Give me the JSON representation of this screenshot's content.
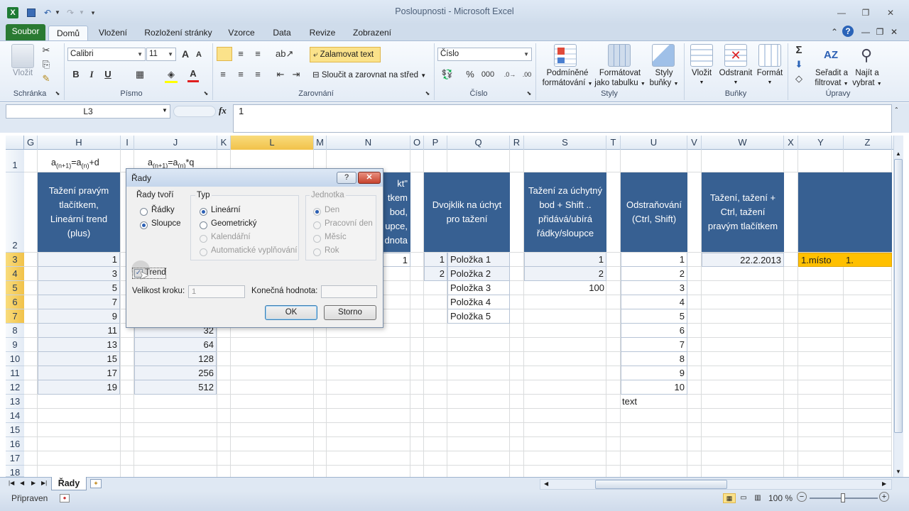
{
  "window": {
    "title": "Posloupnosti - Microsoft Excel"
  },
  "tabs": [
    "Soubor",
    "Domů",
    "Vložení",
    "Rozložení stránky",
    "Vzorce",
    "Data",
    "Revize",
    "Zobrazení"
  ],
  "ribbon": {
    "clipboard": {
      "paste": "Vložit",
      "label": "Schránka"
    },
    "font": {
      "name": "Calibri",
      "size": "11",
      "bold": "B",
      "italic": "I",
      "underline": "U",
      "label": "Písmo",
      "grow": "A",
      "shrink": "A"
    },
    "alignment": {
      "wrap": "Zalamovat text",
      "merge": "Sloučit a zarovnat na střed",
      "label": "Zarovnání"
    },
    "number": {
      "format": "Číslo",
      "percent": "%",
      "thousands": "000",
      "label": "Číslo"
    },
    "styles": {
      "conditional": [
        "Podmíněné",
        "formátování"
      ],
      "table": [
        "Formátovat",
        "jako tabulku"
      ],
      "cell": [
        "Styly",
        "buňky"
      ],
      "label": "Styly"
    },
    "cells": {
      "insert": "Vložit",
      "delete": "Odstranit",
      "format": "Formát",
      "label": "Buňky"
    },
    "editing": {
      "sigma": "Σ",
      "sort": [
        "Seřadit a",
        "filtrovat"
      ],
      "find": [
        "Najít a",
        "vybrat"
      ],
      "label": "Úpravy"
    }
  },
  "formula_bar": {
    "name_box": "L3",
    "fx": "fx",
    "value": "1"
  },
  "columns": [
    "G",
    "H",
    "I",
    "J",
    "K",
    "L",
    "M",
    "N",
    "O",
    "P",
    "Q",
    "R",
    "S",
    "T",
    "U",
    "V",
    "W",
    "X",
    "Y",
    "Z"
  ],
  "rows": [
    "1",
    "2",
    "3",
    "4",
    "5",
    "6",
    "7",
    "8",
    "9",
    "10",
    "11",
    "12",
    "13",
    "14",
    "15",
    "16",
    "17",
    "18"
  ],
  "sheet": {
    "formula_h": {
      "base": "a",
      "s1": "(n+1)",
      "mid": "=a",
      "s2": "(n)",
      "tail": "+d"
    },
    "formula_j": {
      "base": "a",
      "s1": "(n+1)",
      "mid": "=a",
      "s2": "(n)",
      "tail": "*q"
    },
    "header_h": "Tažení pravým tlačítkem, Lineární trend (plus)",
    "values_h": [
      "1",
      "3",
      "5",
      "7",
      "9",
      "11",
      "13",
      "15",
      "17",
      "19"
    ],
    "values_j": [
      "32",
      "64",
      "128",
      "256",
      "512"
    ],
    "header_n": [
      "kt\"",
      "tkem",
      "bod,",
      "upce,",
      "dnota"
    ],
    "value_n": "1",
    "header_q": "Dvojklik na úchyt pro tažení",
    "values_p": [
      "1",
      "2"
    ],
    "values_q": [
      "Položka 1",
      "Položka 2",
      "Položka 3",
      "Položka 4",
      "Položka 5"
    ],
    "header_s": "Tažení za úchytný bod + Shift .. přidává/ubírá řádky/sloupce",
    "values_s": [
      "1",
      "2",
      "100"
    ],
    "header_u": "Odstraňování (Ctrl, Shift)",
    "values_u": [
      "1",
      "2",
      "3",
      "4",
      "5",
      "6",
      "7",
      "8",
      "9",
      "10"
    ],
    "text_u": "text",
    "header_w": "Tažení, tažení + Ctrl, tažení pravým tlačítkem",
    "value_w": "22.2.2013",
    "value_y": "1.místo",
    "value_z": "1."
  },
  "dialog": {
    "title": "Řady",
    "help": "?",
    "close": "✕",
    "rady_tvori": {
      "legend": "Řady tvoří",
      "options": [
        "Řádky",
        "Sloupce"
      ],
      "selected": "Sloupce"
    },
    "typ": {
      "legend": "Typ",
      "options": [
        "Lineární",
        "Geometrický",
        "Kalendářní",
        "Automatické vyplňování"
      ],
      "selected": "Lineární"
    },
    "jednotka": {
      "legend": "Jednotka",
      "options": [
        "Den",
        "Pracovní den",
        "Měsíc",
        "Rok"
      ],
      "selected": "Den"
    },
    "trend": {
      "label": "Trend",
      "checked": true
    },
    "step": {
      "label": "Velikost kroku:",
      "value": "1"
    },
    "stop": {
      "label": "Konečná hodnota:",
      "value": ""
    },
    "ok": "OK",
    "cancel": "Storno"
  },
  "sheet_tab": "Řady",
  "status": {
    "ready": "Připraven",
    "zoom": "100 %"
  }
}
